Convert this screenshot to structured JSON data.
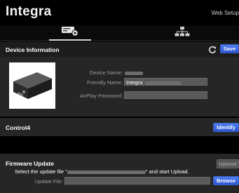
{
  "header": {
    "logo": "Integra",
    "web_setup": "Web Setup"
  },
  "nav": {
    "tabs": [
      {
        "icon": "device-settings-icon",
        "active": true
      },
      {
        "icon": "network-icon",
        "active": false
      }
    ]
  },
  "device_info": {
    "title": "Device Information",
    "save_label": "Save",
    "device_name_label": "Device Name:",
    "friendly_name_label": "Friendly Name:",
    "friendly_name_value": "Integra",
    "airplay_password_label": "AirPlay Password:",
    "airplay_password_value": ""
  },
  "control4": {
    "title": "Control4",
    "identify_label": "Identify"
  },
  "firmware": {
    "title": "Firmware Update",
    "upload_label": "Upload",
    "msg_prefix": "Select the update file \"",
    "msg_suffix": "\" and start Upload.",
    "update_file_label": "Update File:",
    "update_file_value": "",
    "browse_label": "Browse"
  },
  "colors": {
    "accent": "#3b66dc",
    "panel": "#262626",
    "background": "#000000"
  }
}
